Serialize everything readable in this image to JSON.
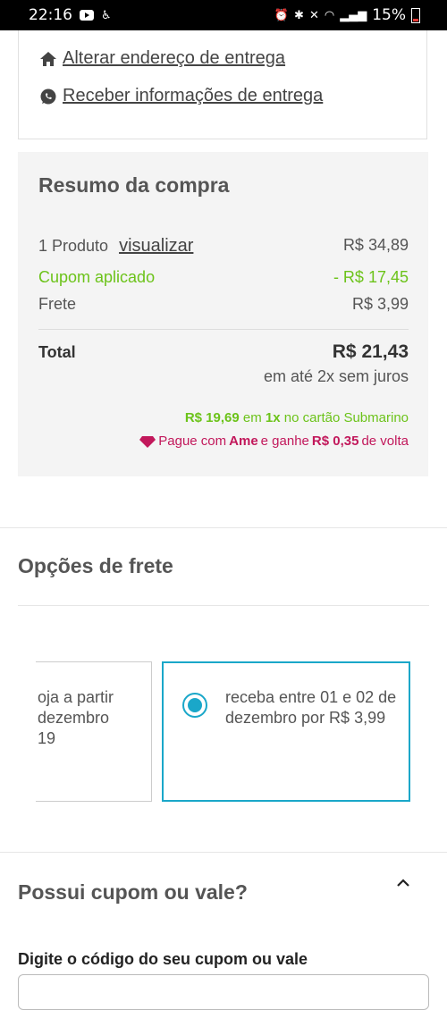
{
  "status_bar": {
    "time": "22:16",
    "battery": "15%",
    "left_icons": [
      "youtube-icon",
      "accessibility-icon"
    ],
    "right_icons": [
      "alarm-icon",
      "bluetooth-icon",
      "mute-icon",
      "wifi-icon",
      "signal-icon",
      "battery-icon"
    ]
  },
  "address": {
    "change_link": "Alterar endereço de entrega",
    "info_link": "Receber informações de entrega"
  },
  "summary": {
    "title": "Resumo da compra",
    "product_label": "1 Produto",
    "view_link": "visualizar",
    "product_value": "R$ 34,89",
    "coupon_label": "Cupom aplicado",
    "coupon_value": "- R$ 17,45",
    "shipping_label": "Frete",
    "shipping_value": "R$ 3,99",
    "total_label": "Total",
    "total_value": "R$ 21,43",
    "installments": "em até 2x sem juros",
    "card_price": "R$ 19,69",
    "card_em": "em",
    "card_times": "1x",
    "card_text": "no cartão Submarino",
    "ame_pre": "Pague com",
    "ame_brand": "Ame",
    "ame_mid": "e ganhe",
    "ame_amount": "R$ 0,35",
    "ame_post": "de volta",
    "colors": {
      "green": "#6cc31a",
      "ame": "#c2185b"
    }
  },
  "shipping_options": {
    "title": "Opções de frete",
    "option_left_text": "oja a partir\ndezembro\n19",
    "option_right_text": "receba entre 01 e 02 de dezembro por R$ 3,99",
    "selected_color": "#1aa7c9"
  },
  "coupon": {
    "title": "Possui cupom ou vale?",
    "field_label": "Digite o código do seu cupom ou vale",
    "input_placeholder": ""
  }
}
